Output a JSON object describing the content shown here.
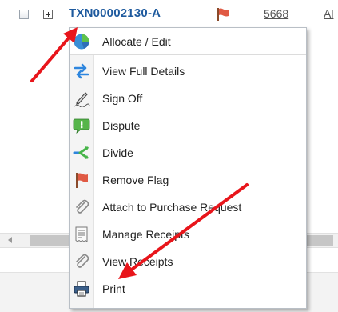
{
  "transaction_row": {
    "id": "TXN00002130-A",
    "amount": "5668",
    "next_column_text": "Al"
  },
  "context_menu": {
    "items": [
      {
        "label": "Allocate / Edit",
        "icon": "pie-chart-icon"
      },
      {
        "label": "View Full Details",
        "icon": "swap-arrows-icon"
      },
      {
        "label": "Sign Off",
        "icon": "pen-signature-icon"
      },
      {
        "label": "Dispute",
        "icon": "speech-bubble-icon"
      },
      {
        "label": "Divide",
        "icon": "split-icon"
      },
      {
        "label": "Remove Flag",
        "icon": "flag-icon"
      },
      {
        "label": "Attach to Purchase Request",
        "icon": "paperclip-icon"
      },
      {
        "label": "Manage Receipts",
        "icon": "receipt-icon"
      },
      {
        "label": "View Receipts",
        "icon": "paperclip-icon"
      },
      {
        "label": "Print",
        "icon": "printer-icon"
      }
    ]
  },
  "colors": {
    "link_blue": "#1e5a9e",
    "annotation_red": "#e8151b",
    "flag_red": "#d84a3a"
  }
}
